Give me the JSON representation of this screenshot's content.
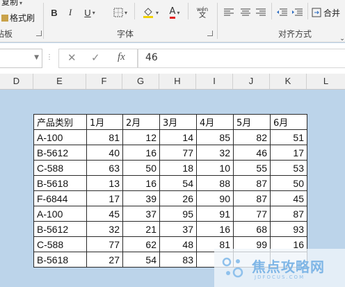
{
  "ribbon": {
    "clipboard": {
      "copy_label": "复制",
      "format_painter_label": "格式刷",
      "group_label": "粘板"
    },
    "font": {
      "group_label": "字体",
      "bold": "B",
      "italic": "I",
      "underline": "U",
      "font_color": "A",
      "phonetic": "wén"
    },
    "alignment": {
      "group_label": "对齐方式",
      "merge_label": "合并"
    }
  },
  "formula_bar": {
    "name_box": "",
    "cancel": "✕",
    "enter": "✓",
    "fx": "fx",
    "value": "46"
  },
  "columns": [
    "D",
    "E",
    "F",
    "G",
    "H",
    "I",
    "J",
    "K",
    "L"
  ],
  "table": {
    "headers": [
      "产品类别",
      "1月",
      "2月",
      "3月",
      "4月",
      "5月",
      "6月"
    ],
    "rows": [
      [
        "A-100",
        "81",
        "12",
        "14",
        "85",
        "82",
        "51"
      ],
      [
        "B-5612",
        "40",
        "16",
        "77",
        "32",
        "46",
        "17"
      ],
      [
        "C-588",
        "63",
        "50",
        "18",
        "10",
        "55",
        "53"
      ],
      [
        "B-5618",
        "13",
        "16",
        "54",
        "88",
        "87",
        "50"
      ],
      [
        "F-6844",
        "17",
        "39",
        "26",
        "90",
        "87",
        "45"
      ],
      [
        "A-100",
        "45",
        "37",
        "95",
        "91",
        "77",
        "87"
      ],
      [
        "B-5612",
        "32",
        "21",
        "37",
        "16",
        "68",
        "93"
      ],
      [
        "C-588",
        "77",
        "62",
        "48",
        "81",
        "99",
        "16"
      ],
      [
        "B-5618",
        "27",
        "54",
        "83",
        "",
        "",
        ""
      ]
    ]
  },
  "watermark": {
    "text": "焦点攻略网",
    "sub": "JDFOCUS.COM"
  }
}
